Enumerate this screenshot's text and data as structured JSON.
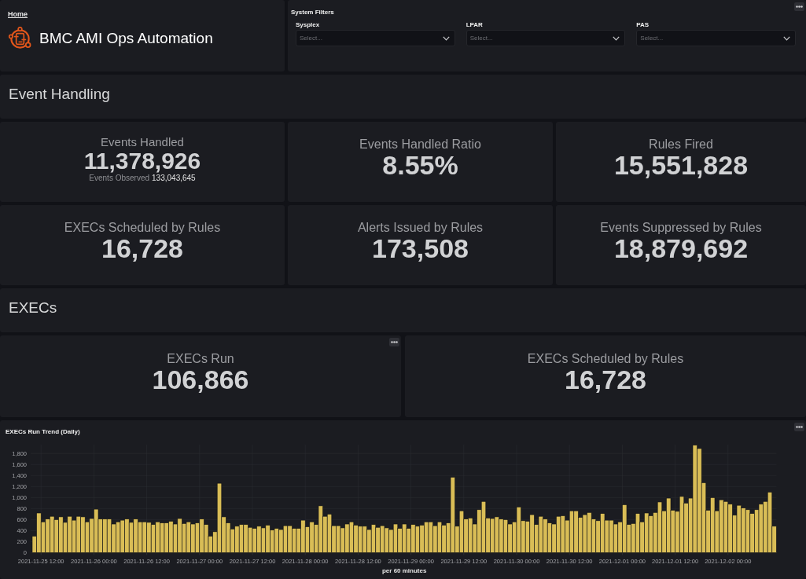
{
  "header": {
    "breadcrumb": "Home",
    "title": "BMC AMI Ops Automation"
  },
  "filters": {
    "title": "System Filters",
    "menu": true,
    "fields": [
      {
        "label": "Sysplex",
        "placeholder": "Select..."
      },
      {
        "label": "LPAR",
        "placeholder": "Select..."
      },
      {
        "label": "PAS",
        "placeholder": "Select..."
      }
    ]
  },
  "sections": [
    {
      "title": "Event Handling",
      "stats": [
        {
          "label": "Events Handled",
          "value": "11,378,926",
          "sub_label": "Events Observed",
          "sub_value": "133,043,645",
          "menu": false
        },
        {
          "label": "Events Handled Ratio",
          "value": "8.55%",
          "menu": false
        },
        {
          "label": "Rules Fired",
          "value": "15,551,828",
          "menu": false
        },
        {
          "label": "EXECs Scheduled by Rules",
          "value": "16,728",
          "menu": false
        },
        {
          "label": "Alerts Issued by Rules",
          "value": "173,508",
          "menu": false
        },
        {
          "label": "Events Suppressed by Rules",
          "value": "18,879,692",
          "menu": false
        }
      ]
    },
    {
      "title": "EXECs",
      "stats": [
        {
          "label": "EXECs Run",
          "value": "106,866",
          "menu": true
        },
        {
          "label": "EXECs Scheduled by Rules",
          "value": "16,728",
          "menu": false
        }
      ]
    }
  ],
  "chart_panel": {
    "menu": true,
    "chart_data": {
      "type": "bar",
      "title": "EXECs Run Trend (Daily)",
      "xlabel": "per 60 minutes",
      "grid": true,
      "categories": [
        null,
        null,
        "2021-11-25 12:00",
        null,
        null,
        null,
        null,
        null,
        null,
        null,
        null,
        null,
        null,
        null,
        "2021-11-26 00:00",
        null,
        null,
        null,
        null,
        null,
        null,
        null,
        null,
        null,
        null,
        null,
        "2021-11-26 12:00",
        null,
        null,
        null,
        null,
        null,
        null,
        null,
        null,
        null,
        null,
        null,
        "2021-11-27 00:00",
        null,
        null,
        null,
        null,
        null,
        null,
        null,
        null,
        null,
        null,
        null,
        "2021-11-27 12:00",
        null,
        null,
        null,
        null,
        null,
        null,
        null,
        null,
        null,
        null,
        null,
        "2021-11-28 00:00",
        null,
        null,
        null,
        null,
        null,
        null,
        null,
        null,
        null,
        null,
        null,
        "2021-11-28 12:00",
        null,
        null,
        null,
        null,
        null,
        null,
        null,
        null,
        null,
        null,
        null,
        "2021-11-29 00:00",
        null,
        null,
        null,
        null,
        null,
        null,
        null,
        null,
        null,
        null,
        null,
        "2021-11-29 12:00",
        null,
        null,
        null,
        null,
        null,
        null,
        null,
        null,
        null,
        null,
        null,
        "2021-11-30 00:00",
        null,
        null,
        null,
        null,
        null,
        null,
        null,
        null,
        null,
        null,
        null,
        "2021-11-30 12:00",
        null,
        null,
        null,
        null,
        null,
        null,
        null,
        null,
        null,
        null,
        null,
        "2021-12-01 00:00",
        null,
        null,
        null,
        null,
        null,
        null,
        null,
        null,
        null,
        null,
        null,
        "2021-12-01 12:00",
        null,
        null,
        null,
        null,
        null,
        null,
        null,
        null,
        null,
        null,
        null,
        "2021-12-02 00:00",
        null,
        null,
        null,
        null,
        null,
        null,
        null,
        null,
        null,
        null
      ],
      "values": [
        300,
        720,
        560,
        610,
        660,
        600,
        650,
        550,
        660,
        590,
        660,
        650,
        560,
        620,
        790,
        610,
        610,
        610,
        520,
        560,
        590,
        610,
        550,
        610,
        560,
        560,
        550,
        510,
        560,
        540,
        540,
        570,
        520,
        620,
        530,
        560,
        520,
        540,
        610,
        510,
        300,
        380,
        1260,
        650,
        540,
        430,
        480,
        510,
        510,
        460,
        440,
        480,
        450,
        500,
        410,
        440,
        420,
        490,
        490,
        440,
        440,
        590,
        470,
        560,
        510,
        850,
        660,
        700,
        490,
        490,
        450,
        520,
        560,
        500,
        480,
        480,
        420,
        510,
        460,
        490,
        450,
        420,
        520,
        440,
        520,
        440,
        510,
        480,
        500,
        560,
        560,
        490,
        560,
        500,
        540,
        1370,
        480,
        760,
        610,
        630,
        520,
        780,
        930,
        630,
        620,
        650,
        610,
        600,
        520,
        560,
        830,
        580,
        570,
        690,
        510,
        660,
        610,
        540,
        520,
        660,
        670,
        590,
        760,
        760,
        640,
        690,
        730,
        610,
        580,
        710,
        590,
        590,
        520,
        560,
        870,
        510,
        530,
        710,
        560,
        720,
        670,
        730,
        920,
        760,
        990,
        770,
        750,
        1020,
        900,
        990,
        1950,
        1890,
        1270,
        770,
        1000,
        760,
        960,
        930,
        880,
        680,
        860,
        810,
        780,
        710,
        780,
        880,
        930,
        1100,
        480
      ],
      "ylim": [
        0,
        1960
      ],
      "yticks": [
        {
          "value": 0,
          "label": "0"
        },
        {
          "value": 200,
          "label": "200"
        },
        {
          "value": 400,
          "label": "400"
        },
        {
          "value": 600,
          "label": "600"
        },
        {
          "value": 800,
          "label": "800"
        },
        {
          "value": 1000,
          "label": "1,000"
        },
        {
          "value": 1200,
          "label": "1,200"
        },
        {
          "value": 1400,
          "label": "1,400"
        },
        {
          "value": 1600,
          "label": "1,600"
        },
        {
          "value": 1800,
          "label": "1,800"
        }
      ]
    }
  }
}
